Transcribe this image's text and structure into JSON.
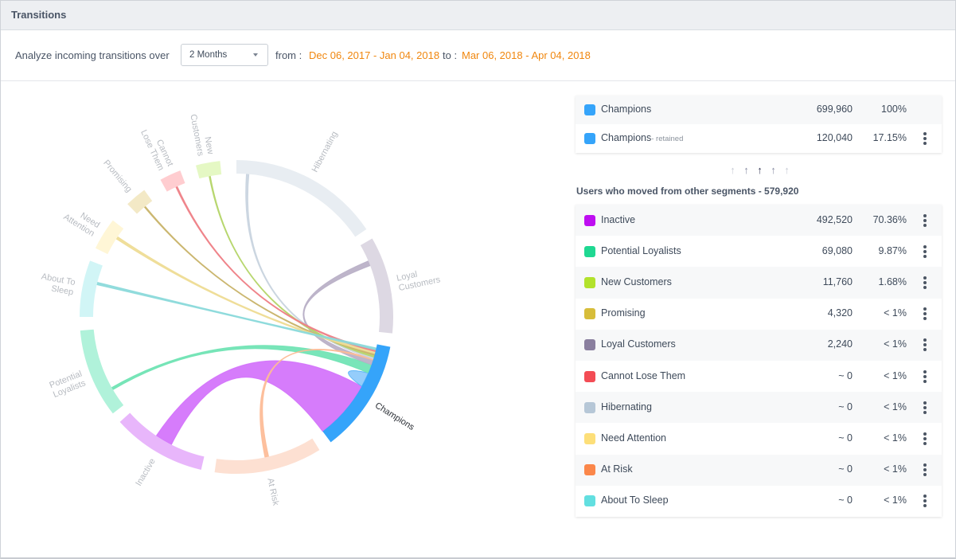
{
  "header": {
    "title": "Transitions"
  },
  "toolbar": {
    "label": "Analyze incoming transitions over",
    "period_select": {
      "value": "2 Months"
    },
    "from_label": "from :",
    "from_range": "Dec 06, 2017 - Jan 04, 2018",
    "to_label": "to :",
    "to_range": "Mar 06, 2018 - Apr 04, 2018"
  },
  "colors": {
    "accent_orange": "#f0870f",
    "champions": "#35a4fa"
  },
  "summary": {
    "rows": [
      {
        "name": "Champions",
        "sub": "",
        "count": "699,960",
        "pct": "100%",
        "color": "#35a4fa",
        "menu": false
      },
      {
        "name": "Champions",
        "sub": "- retained",
        "count": "120,040",
        "pct": "17.15%",
        "color": "#35a4fa",
        "menu": true
      }
    ]
  },
  "arrows": {
    "icon": "up-arrow-icon",
    "count": 5,
    "colors": [
      "#c9ccd6",
      "#8d90a6",
      "#3b3d5a",
      "#8d90a6",
      "#c9ccd6"
    ]
  },
  "moved": {
    "title": "Users who moved from other segments - 579,920",
    "rows": [
      {
        "name": "Inactive",
        "count": "492,520",
        "pct": "70.36%",
        "color": "#be0ef1"
      },
      {
        "name": "Potential Loyalists",
        "count": "69,080",
        "pct": "9.87%",
        "color": "#1fd892"
      },
      {
        "name": "New Customers",
        "count": "11,760",
        "pct": "1.68%",
        "color": "#b2e22c"
      },
      {
        "name": "Promising",
        "count": "4,320",
        "pct": "< 1%",
        "color": "#d7bd3a"
      },
      {
        "name": "Loyal Customers",
        "count": "2,240",
        "pct": "< 1%",
        "color": "#8a7f9f"
      },
      {
        "name": "Cannot Lose Them",
        "count": "~ 0",
        "pct": "< 1%",
        "color": "#f34c55"
      },
      {
        "name": "Hibernating",
        "count": "~ 0",
        "pct": "< 1%",
        "color": "#b6c7d7"
      },
      {
        "name": "Need Attention",
        "count": "~ 0",
        "pct": "< 1%",
        "color": "#fddf79"
      },
      {
        "name": "At Risk",
        "count": "~ 0",
        "pct": "< 1%",
        "color": "#fb874a"
      },
      {
        "name": "About To Sleep",
        "count": "~ 0",
        "pct": "< 1%",
        "color": "#62dfe0"
      }
    ]
  },
  "chord_data": {
    "type": "chord",
    "focus": "Champions",
    "segments": [
      {
        "name": "Hibernating",
        "label": [
          "Hibernating"
        ],
        "arc_color": "#e8edf2",
        "ribbon_color": "#c9d4df",
        "start_deg": 0,
        "end_deg": 56
      },
      {
        "name": "Loyal Customers",
        "label": [
          "Loyal",
          "Customers"
        ],
        "arc_color": "#ddd8e3",
        "ribbon_color": "#b8afc6",
        "start_deg": 60,
        "end_deg": 96
      },
      {
        "name": "Champions",
        "label": [
          "Champions"
        ],
        "arc_color": "#35a4fa",
        "ribbon_color": "#8cc9fb",
        "start_deg": 101,
        "end_deg": 143
      },
      {
        "name": "At Risk",
        "label": [
          "At Risk"
        ],
        "arc_color": "#fde0d2",
        "ribbon_color": "#fdbb96",
        "start_deg": 148,
        "end_deg": 188
      },
      {
        "name": "Inactive",
        "label": [
          "Inactive"
        ],
        "arc_color": "#e8b6fb",
        "ribbon_color": "#d371fb",
        "start_deg": 193,
        "end_deg": 228
      },
      {
        "name": "Potential Loyalists",
        "label": [
          "Potential",
          "Loyalists"
        ],
        "arc_color": "#b0f2da",
        "ribbon_color": "#6ee3b3",
        "start_deg": 232,
        "end_deg": 265
      },
      {
        "name": "About To Sleep",
        "label": [
          "About To",
          "Sleep"
        ],
        "arc_color": "#d1f5f6",
        "ribbon_color": "#8ad9da",
        "start_deg": 270,
        "end_deg": 291
      },
      {
        "name": "Need Attention",
        "label": [
          "Need",
          "Attention"
        ],
        "arc_color": "#fff6d6",
        "ribbon_color": "#eedc94",
        "start_deg": 296,
        "end_deg": 308
      },
      {
        "name": "Promising",
        "label": [
          "Promising"
        ],
        "arc_color": "#f3e9c6",
        "ribbon_color": "#c9b46a",
        "start_deg": 316,
        "end_deg": 324
      },
      {
        "name": "Cannot Lose Them",
        "label": [
          "Cannot",
          "Lose Them"
        ],
        "arc_color": "#ffcdd0",
        "ribbon_color": "#ee7f86",
        "start_deg": 331,
        "end_deg": 339
      },
      {
        "name": "New Customers",
        "label": [
          "New",
          "Customers"
        ],
        "arc_color": "#e5f8c4",
        "ribbon_color": "#b5d569",
        "start_deg": 345,
        "end_deg": 354
      }
    ],
    "ribbons": [
      {
        "from": "Inactive",
        "src": [
          207,
          214
        ],
        "dst": [
          119,
          143
        ]
      },
      {
        "from": "Champions",
        "src": [
          113,
          119
        ],
        "dst": [
          113,
          119
        ],
        "self": true
      },
      {
        "from": "Potential Loyalists",
        "src": [
          239.5,
          240.5
        ],
        "dst": [
          109.5,
          113
        ]
      },
      {
        "from": "Loyal Customers",
        "src": [
          67,
          69
        ],
        "dst": [
          107.5,
          109.5
        ]
      },
      {
        "from": "At Risk",
        "src": [
          167,
          168.5
        ],
        "dst": [
          107,
          107.5
        ]
      },
      {
        "from": "Hibernating",
        "src": [
          4,
          5
        ],
        "dst": [
          106.3,
          107
        ]
      },
      {
        "from": "New Customers",
        "src": [
          349,
          349.5
        ],
        "dst": [
          105.5,
          106.3
        ]
      },
      {
        "from": "Promising",
        "src": [
          320,
          320.5
        ],
        "dst": [
          104.8,
          105.5
        ]
      },
      {
        "from": "Need Attention",
        "src": [
          303,
          304
        ],
        "dst": [
          104,
          104.8
        ]
      },
      {
        "from": "Cannot Lose Them",
        "src": [
          335,
          335.6
        ],
        "dst": [
          103.3,
          104
        ]
      },
      {
        "from": "About To Sleep",
        "src": [
          283,
          284
        ],
        "dst": [
          102.5,
          103.3
        ]
      }
    ]
  }
}
